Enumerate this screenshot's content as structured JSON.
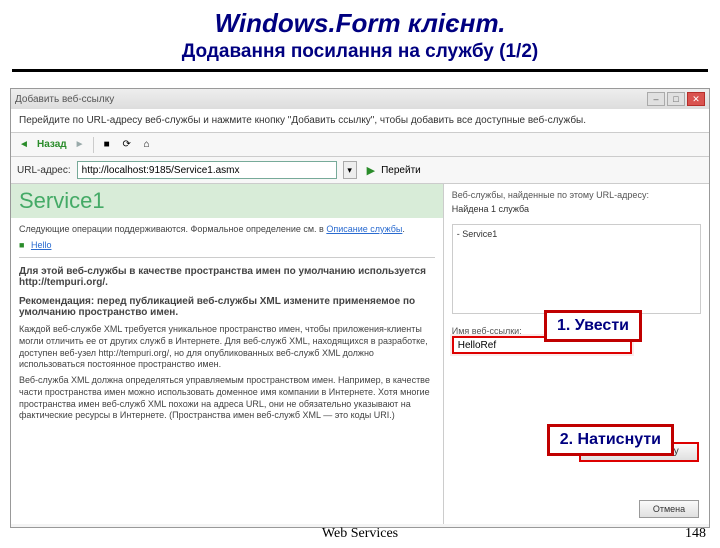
{
  "slide": {
    "title": "Windows.Form клієнт.",
    "subtitle": "Додавання посилання на службу (1/2)"
  },
  "window": {
    "title": "Добавить веб-ссылку",
    "close_glyph": "✕",
    "min_glyph": "–",
    "max_glyph": "□"
  },
  "instruction": "Перейдите по URL-адресу веб-службы и нажмите кнопку \"Добавить ссылку\", чтобы добавить все доступные веб-службы.",
  "toolbar": {
    "back_label": "Назад",
    "back_glyph": "◄",
    "stop_glyph": "■",
    "refresh_glyph": "⟳",
    "home_glyph": "⌂"
  },
  "url": {
    "label": "URL-адрес:",
    "value": "http://localhost:9185/Service1.asmx",
    "dropdown_glyph": "▾",
    "go_glyph": "▶",
    "go_label": "Перейти"
  },
  "left": {
    "service_title": "Service1",
    "ops_text": "Следующие операции поддерживаются. Формальное определение см. в",
    "desc_link": "Описание службы",
    "hello_link": "Hello",
    "block1_bold": "Для этой веб-службы в качестве пространства имен по умолчанию используется http://tempuri.org/.",
    "block2_bold": "Рекомендация: перед публикацией веб-службы XML измените применяемое по умолчанию пространство имен.",
    "para3": "Каждой веб-службе XML требуется уникальное пространство имен, чтобы приложения-клиенты могли отличить ее от других служб в Интернете. Для веб-служб XML, находящихся в разработке, доступен веб-узел http://tempuri.org/, но для опубликованных веб-служб XML должно использоваться постоянное пространство имен.",
    "para4": "Веб-служба XML должна определяться управляемым пространством имен. Например, в качестве части пространства имен можно использовать доменное имя компании в Интернете. Хотя многие пространства имен веб-служб XML похожи на адреса URL, они не обязательно указывают на фактические ресурсы в Интернете. (Пространства имен веб-служб XML — это коды URI.)"
  },
  "right": {
    "header": "Веб-службы, найденные по этому URL-адресу:",
    "found": "Найдена 1 служба",
    "item": "- Service1",
    "ref_label": "Имя веб-ссылки:",
    "ref_value": "HelloRef",
    "add_button": "Добавить ссылку",
    "cancel_button": "Отмена"
  },
  "callouts": {
    "step1": "1. Увести",
    "step2": "2. Натиснути"
  },
  "footer": {
    "label": "Web Services",
    "page": "148"
  }
}
